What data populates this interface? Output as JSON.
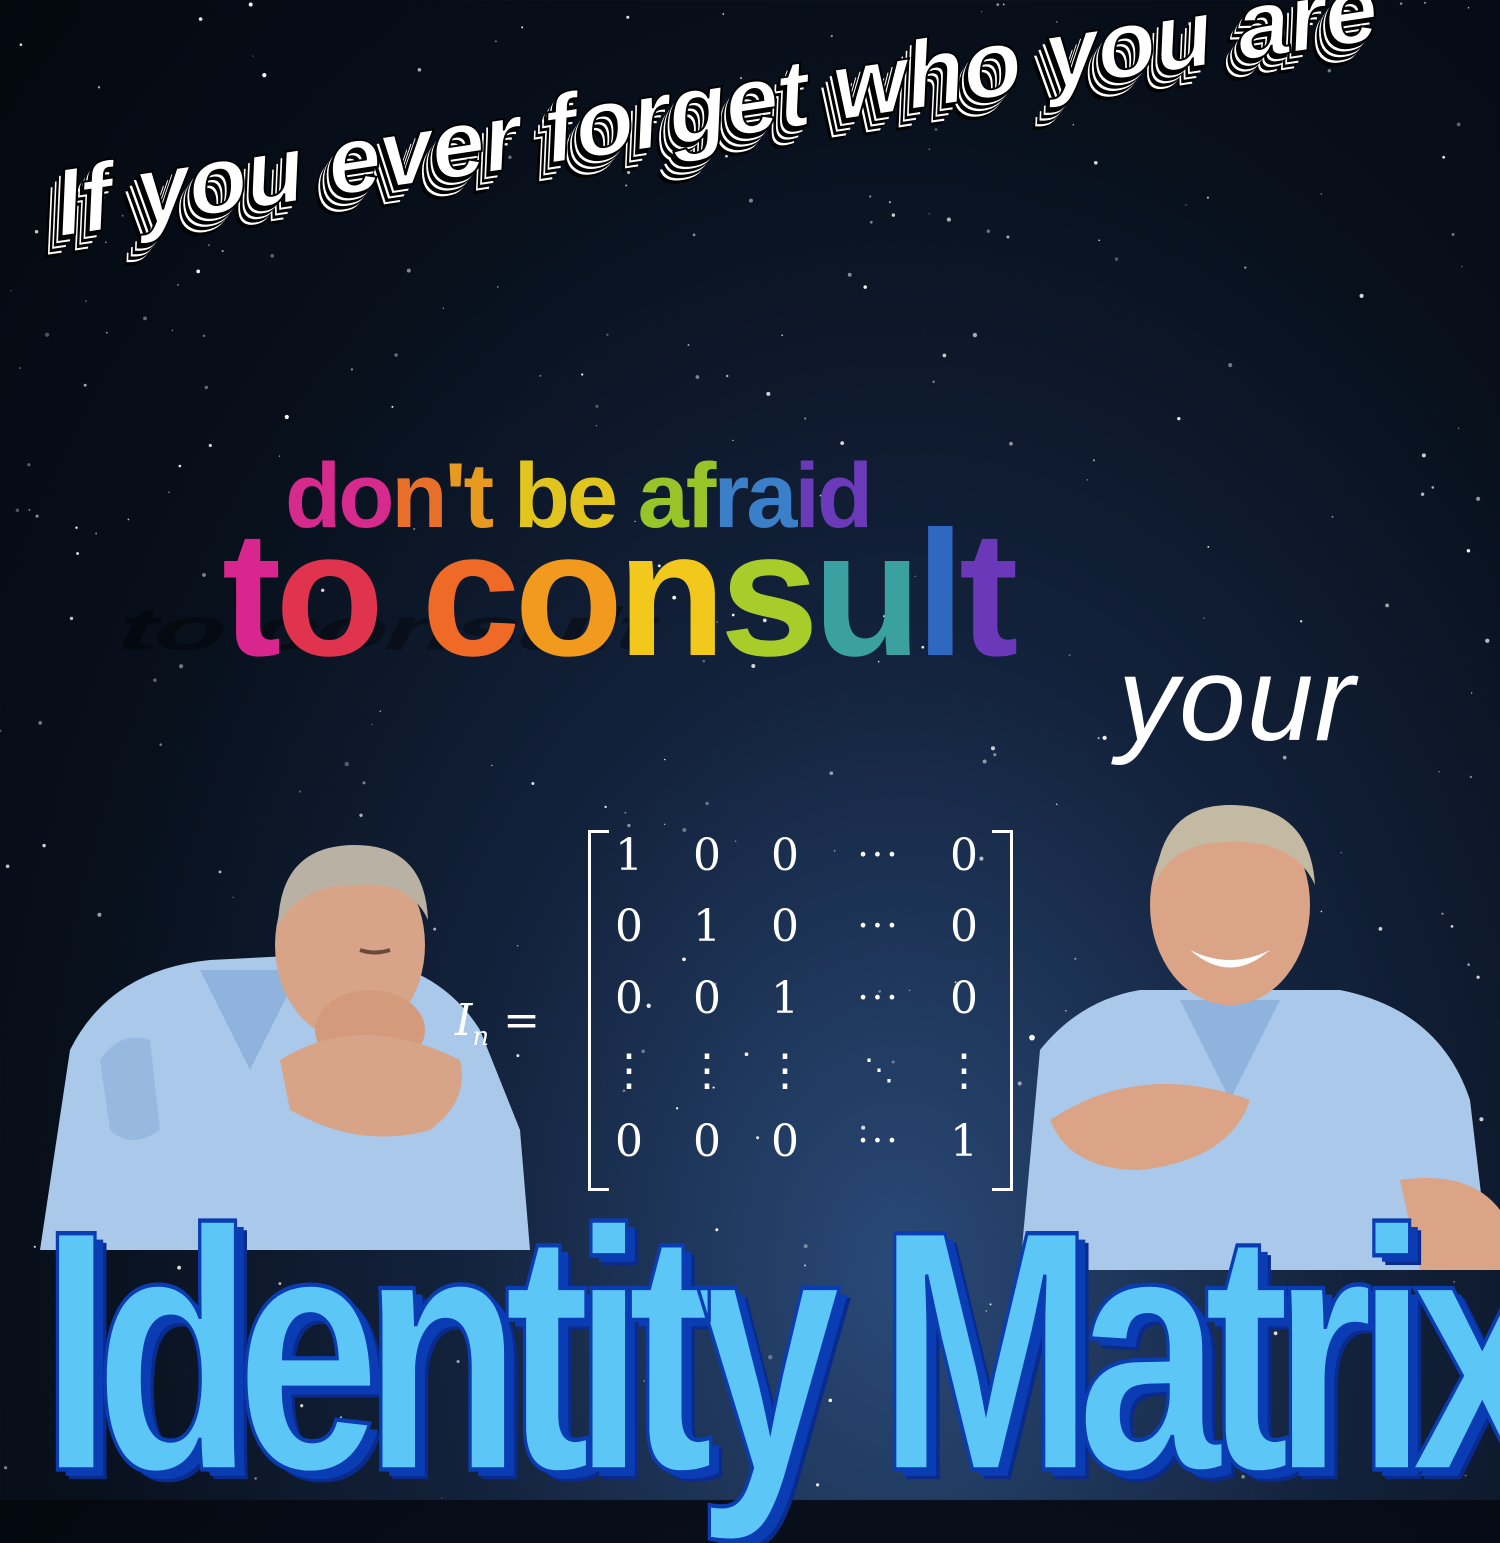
{
  "headline": "If you ever forget who you are",
  "rainbow": {
    "line1": [
      "do",
      "n",
      "'t ",
      "be ",
      "af",
      "ra",
      "id"
    ],
    "line1_colors": [
      "#d62a8c",
      "#e8702a",
      "#e89a20",
      "#e2c41e",
      "#98c42a",
      "#3a7fc8",
      "#6a3ab8"
    ],
    "line2": [
      "t",
      "o ",
      "c",
      "o",
      "n",
      "s",
      "u",
      "l",
      "t"
    ],
    "line2_colors": [
      "#d9268e",
      "#e0344e",
      "#ee6a26",
      "#f29a1e",
      "#f2c81c",
      "#a8cc2a",
      "#3aa0a0",
      "#2f68c0",
      "#6a38b8"
    ]
  },
  "your": "your",
  "matrix": {
    "label_var": "I",
    "label_sub": "n",
    "label_eq": " =",
    "rows": [
      [
        "1",
        "0",
        "0",
        "···",
        "0"
      ],
      [
        "0",
        "1",
        "0",
        "···",
        "0"
      ],
      [
        "0",
        "0",
        "1",
        "···",
        "0"
      ],
      [
        "⋮",
        "⋮",
        "⋮",
        "⋱",
        "⋮"
      ],
      [
        "0",
        "0",
        "0",
        "···",
        "1"
      ]
    ],
    "period": "."
  },
  "title": "Identity Matrix",
  "colors": {
    "title_fill": "#5cc7f6",
    "title_outline": "#0a3cb4",
    "shirt": "#a9c8ea",
    "skin": "#d8a487",
    "hair": "#b9b2a4"
  }
}
